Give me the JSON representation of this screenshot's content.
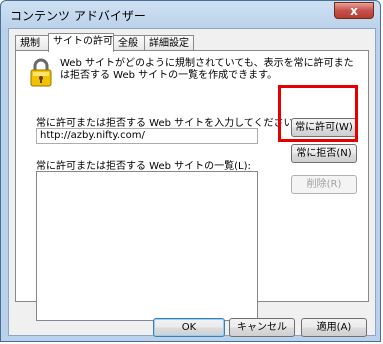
{
  "window": {
    "title": "コンテンツ アドバイザー",
    "close_glyph": "x"
  },
  "tabs": [
    {
      "label": "規制"
    },
    {
      "label": "サイトの許可"
    },
    {
      "label": "全般"
    },
    {
      "label": "詳細設定"
    }
  ],
  "panel": {
    "description": "Web サイトがどのように規制されていても、表示を常に許可または拒否する Web サイトの一覧を作成できます。",
    "url_label": "常に許可または拒否する Web サイトを入力してください(T):",
    "url_value": "http://azby.nifty.com/",
    "list_label": "常に許可または拒否する Web サイトの一覧(L):",
    "list_items": []
  },
  "buttons": {
    "always_allow": "常に許可(W)",
    "always_deny": "常に拒否(N)",
    "remove": "削除(R)",
    "ok": "OK",
    "cancel": "キャンセル",
    "apply": "適用(A)"
  },
  "colors": {
    "highlight": "#e60000"
  }
}
